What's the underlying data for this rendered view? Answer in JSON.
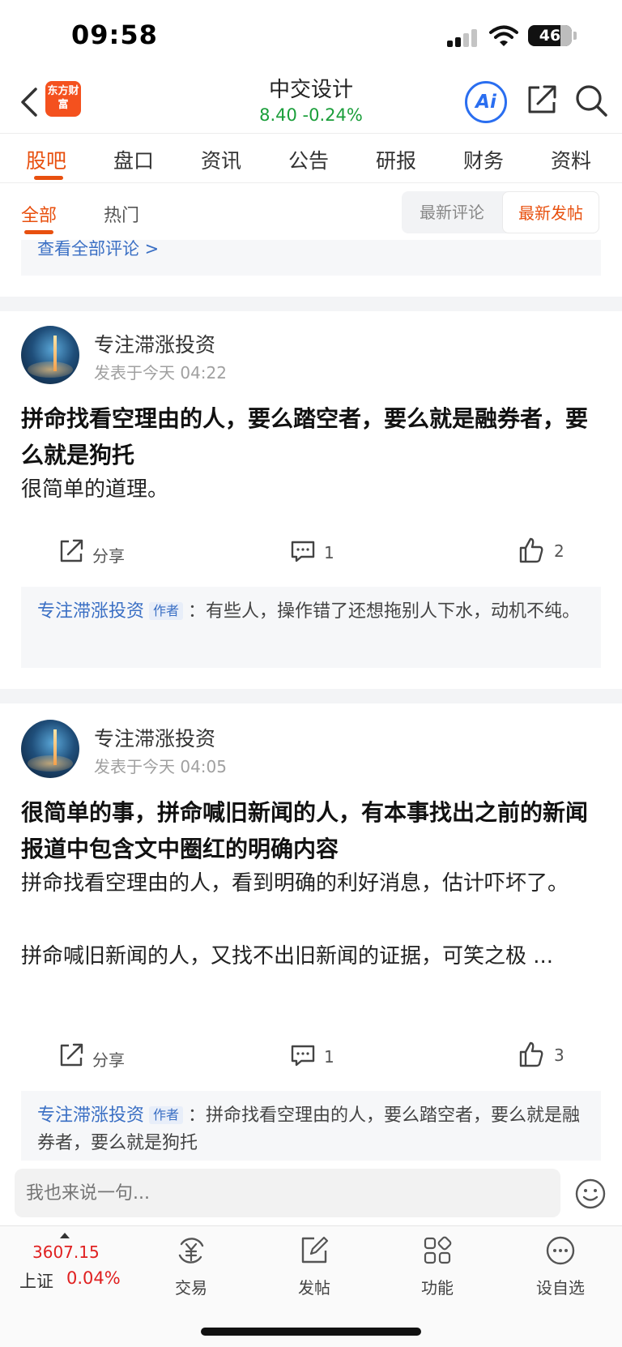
{
  "status_bar": {
    "time": "09:58",
    "battery": "46"
  },
  "header": {
    "logo_text": "东方财富",
    "stock_name": "中交设计",
    "stock_quote": "8.40  -0.24%",
    "ai_label": "Ai"
  },
  "main_tabs": [
    "股吧",
    "盘口",
    "资讯",
    "公告",
    "研报",
    "财务",
    "资料"
  ],
  "sub_tabs": {
    "all": "全部",
    "hot": "热门",
    "sort_latest_comment": "最新评论",
    "sort_latest_post": "最新发帖"
  },
  "view_all_comments": "查看全部评论 >",
  "posts": [
    {
      "author": "专注滞涨投资",
      "time": "发表于今天 04:22",
      "title": "拼命找看空理由的人，要么踏空者，要么就是融券者，要么就是狗托",
      "body": "很简单的道理。",
      "share_label": "分享",
      "comments": "1",
      "likes": "2",
      "reply": {
        "author": "专注滞涨投资",
        "tag": "作者",
        "text": "：有些人，操作错了还想拖别人下水，动机不纯。"
      }
    },
    {
      "author": "专注滞涨投资",
      "time": "发表于今天 04:05",
      "title": "很简单的事，拼命喊旧新闻的人，有本事找出之前的新闻报道中包含文中圈红的明确内容",
      "body_line1": "拼命找看空理由的人，看到明确的利好消息，估计吓坏了。",
      "body_line2": "拼命喊旧新闻的人，又找不出旧新闻的证据，可笑之极 ...",
      "share_label": "分享",
      "comments": "1",
      "likes": "3",
      "reply": {
        "author": "专注滞涨投资",
        "tag": "作者",
        "text": "：拼命找看空理由的人，要么踏空者，要么就是融券者，要么就是狗托"
      }
    }
  ],
  "comment_input": {
    "placeholder": "我也来说一句..."
  },
  "bottom_nav": {
    "index_value": "3607.15",
    "index_name": "上证",
    "index_change": "0.04%",
    "items": [
      "交易",
      "发帖",
      "功能",
      "设自选"
    ]
  },
  "colors": {
    "accent": "#e8500f",
    "up": "#e02020",
    "down": "#1a9e3a",
    "link": "#3a6fc4"
  }
}
